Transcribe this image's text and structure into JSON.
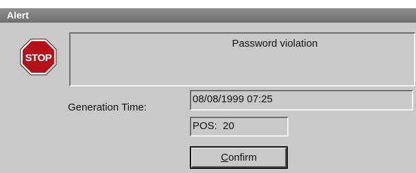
{
  "window": {
    "title": "Alert"
  },
  "icon": {
    "name": "stop-icon",
    "text": "STOP",
    "color": "#b3121a"
  },
  "message": {
    "text": "Password violation"
  },
  "generation_time": {
    "label": "Generation Time:",
    "value": "08/08/1999 07:25"
  },
  "position": {
    "value": "POS:  20"
  },
  "confirm_button": {
    "accel": "C",
    "rest": "onfirm"
  }
}
